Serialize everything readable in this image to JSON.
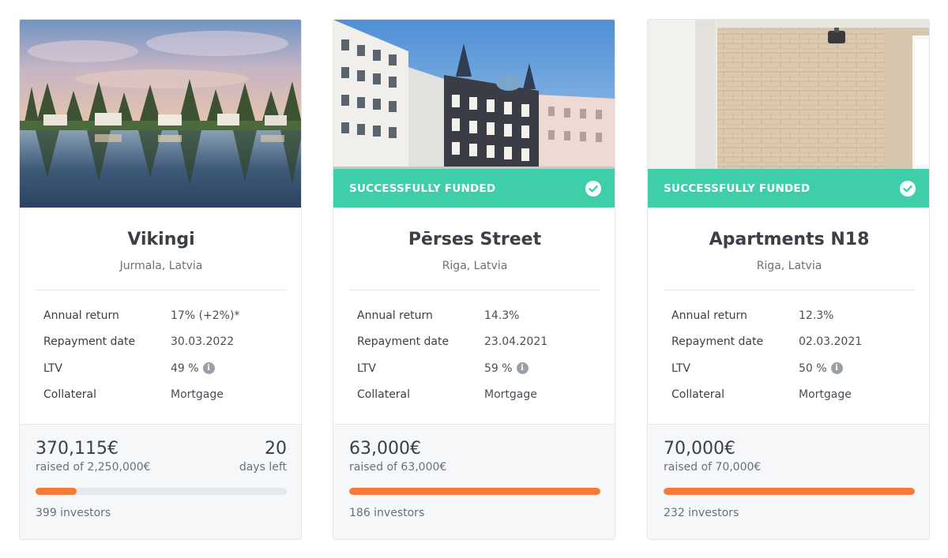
{
  "cards": [
    {
      "title": "Vikingi",
      "location": "Jurmala, Latvia",
      "funded": false,
      "specs": {
        "annual_return_label": "Annual return",
        "annual_return_value": "17% (+2%)*",
        "repayment_label": "Repayment date",
        "repayment_value": "30.03.2022",
        "ltv_label": "LTV",
        "ltv_value": "49 %",
        "collateral_label": "Collateral",
        "collateral_value": "Mortgage"
      },
      "raised": "370,115€",
      "raised_of": "raised of 2,250,000€",
      "days_left_number": "20",
      "days_left_label": "days left",
      "progress": 0.165,
      "investors": "399 investors"
    },
    {
      "title": "Pērses Street",
      "location": "Riga, Latvia",
      "funded": true,
      "funded_label": "SUCCESSFULLY FUNDED",
      "specs": {
        "annual_return_label": "Annual return",
        "annual_return_value": "14.3%",
        "repayment_label": "Repayment date",
        "repayment_value": "23.04.2021",
        "ltv_label": "LTV",
        "ltv_value": "59 %",
        "collateral_label": "Collateral",
        "collateral_value": "Mortgage"
      },
      "raised": "63,000€",
      "raised_of": "raised of 63,000€",
      "progress": 1.0,
      "investors": "186 investors"
    },
    {
      "title": "Apartments N18",
      "location": "Riga, Latvia",
      "funded": true,
      "funded_label": "SUCCESSFULLY FUNDED",
      "specs": {
        "annual_return_label": "Annual return",
        "annual_return_value": "12.3%",
        "repayment_label": "Repayment date",
        "repayment_value": "02.03.2021",
        "ltv_label": "LTV",
        "ltv_value": "50 %",
        "collateral_label": "Collateral",
        "collateral_value": "Mortgage"
      },
      "raised": "70,000€",
      "raised_of": "raised of 70,000€",
      "progress": 1.0,
      "investors": "232 investors"
    }
  ],
  "colors": {
    "funded_banner": "#3ecfaa",
    "progress_fill": "#f47a36",
    "progress_track": "#e5e8ec"
  },
  "icons": {
    "funded": "check-circle-icon",
    "ltv_info": "info-icon"
  }
}
